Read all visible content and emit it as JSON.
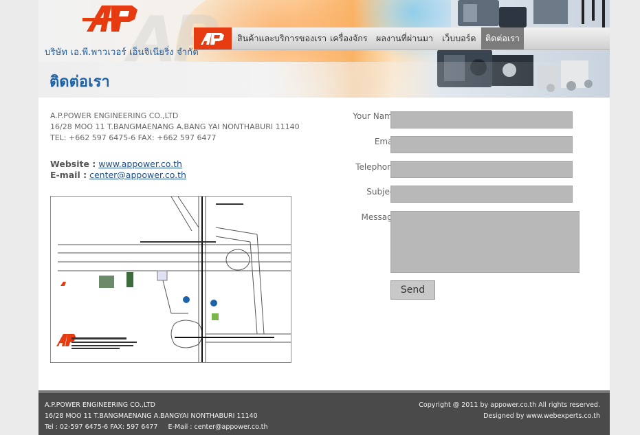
{
  "header": {
    "company_name": "บริษัท เอ.พี.พาวเวอร์ เอ็นจิเนียริ่ง จำกัด",
    "logo_text": "AP",
    "watermark_text": "AP"
  },
  "nav": {
    "logo_text": "AP",
    "items": [
      {
        "label": "สินค้าและบริการของเรา"
      },
      {
        "label": "เครื่องจักร"
      },
      {
        "label": "ผลงานที่ผ่านมา"
      },
      {
        "label": "เว็บบอร์ด"
      },
      {
        "label": "ติดต่อเรา",
        "active": true
      }
    ]
  },
  "page_title": "ติดต่อเรา",
  "contact": {
    "company": "A.P.POWER ENGINEERING CO.,LTD",
    "address": "16/28 MOO 11 T.BANGMAENANG A.BANG YAI NONTHABURI 11140",
    "tel": "TEL: +662 597 6475-6 FAX: +662 597 6477",
    "website_label": "Website :",
    "website": "www.appower.co.th",
    "email_label": "E-mail :",
    "email": "center@appower.co.th"
  },
  "form": {
    "name_label": "Your Name :",
    "email_label": "Email :",
    "telephone_label": "Telephone :",
    "subject_label": "Subject :",
    "message_label": "Message :",
    "send_label": "Send"
  },
  "footer": {
    "company": "A.P.POWER ENGINEERING CO.,LTD",
    "address": "16/28 MOO 11 T.BANGMAENANG A.BANGYAI NONTHABURI 11140",
    "contact": "Tel : 02-597 6475-6 FAX: 597 6477     E-Mail : center@appower.co.th",
    "copyright": "Copyright @ 2011 by appower.co.th All rights reserved.",
    "designed": "Designed by www.webexperts.co.th"
  },
  "colors": {
    "accent_red": "#e63b10",
    "title_blue": "#1c63aa",
    "footer_bg": "#4a4a4a"
  }
}
